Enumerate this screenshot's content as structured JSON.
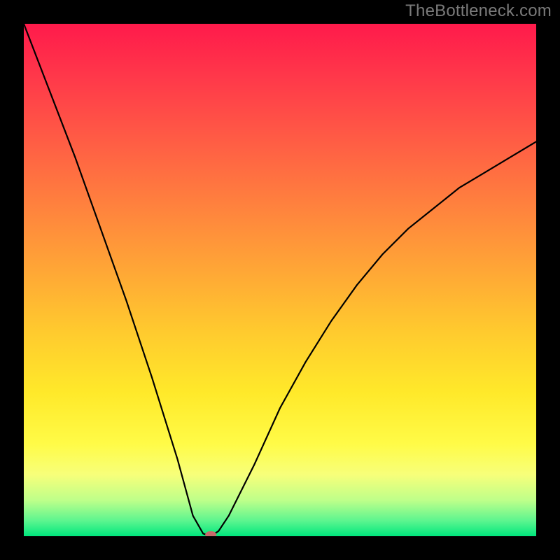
{
  "watermark": "TheBottleneck.com",
  "chart_data": {
    "type": "line",
    "title": "",
    "xlabel": "",
    "ylabel": "",
    "xlim": [
      0,
      100
    ],
    "ylim": [
      0,
      100
    ],
    "legend": false,
    "grid": false,
    "series": [
      {
        "name": "bottleneck-curve",
        "x": [
          0,
          5,
          10,
          15,
          20,
          25,
          30,
          33,
          35,
          36.5,
          38,
          40,
          45,
          50,
          55,
          60,
          65,
          70,
          75,
          80,
          85,
          90,
          95,
          100
        ],
        "y": [
          100,
          87,
          74,
          60,
          46,
          31,
          15,
          4,
          0.5,
          0,
          1,
          4,
          14,
          25,
          34,
          42,
          49,
          55,
          60,
          64,
          68,
          71,
          74,
          77
        ]
      }
    ],
    "marker": {
      "x": 36.5,
      "y": 0.3,
      "color": "#c76a6b"
    },
    "background_gradient": {
      "direction": "top-to-bottom",
      "stops": [
        {
          "pos": 0.0,
          "color": "#ff1a4b"
        },
        {
          "pos": 0.35,
          "color": "#ff803e"
        },
        {
          "pos": 0.72,
          "color": "#ffe92a"
        },
        {
          "pos": 0.93,
          "color": "#beff8a"
        },
        {
          "pos": 1.0,
          "color": "#00e77d"
        }
      ]
    }
  }
}
